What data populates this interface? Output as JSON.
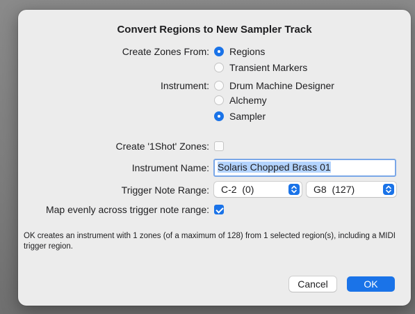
{
  "dialog": {
    "title": "Convert Regions to New Sampler Track",
    "create_zones_from": {
      "label": "Create Zones From:",
      "options": [
        {
          "label": "Regions",
          "selected": true
        },
        {
          "label": "Transient Markers",
          "selected": false
        }
      ]
    },
    "instrument": {
      "label": "Instrument:",
      "options": [
        {
          "label": "Drum Machine Designer",
          "selected": false
        },
        {
          "label": "Alchemy",
          "selected": false
        },
        {
          "label": "Sampler",
          "selected": true
        }
      ]
    },
    "oneshot": {
      "label": "Create '1Shot' Zones:",
      "checked": false
    },
    "instrument_name": {
      "label": "Instrument Name:",
      "value": "Solaris Chopped Brass 01"
    },
    "trigger_note_range": {
      "label": "Trigger Note Range:",
      "low": "C-2  (0)",
      "high": "G8  (127)"
    },
    "map_evenly": {
      "label": "Map evenly across trigger note range:",
      "checked": true
    },
    "info_text": "OK creates an instrument with 1 zones (of a maximum of 128) from 1 selected region(s), including a MIDI trigger region.",
    "buttons": {
      "cancel": "Cancel",
      "ok": "OK"
    }
  },
  "colors": {
    "accent": "#1a73e8",
    "dialog_bg": "#ececec",
    "backdrop": "#7a7a7a"
  }
}
